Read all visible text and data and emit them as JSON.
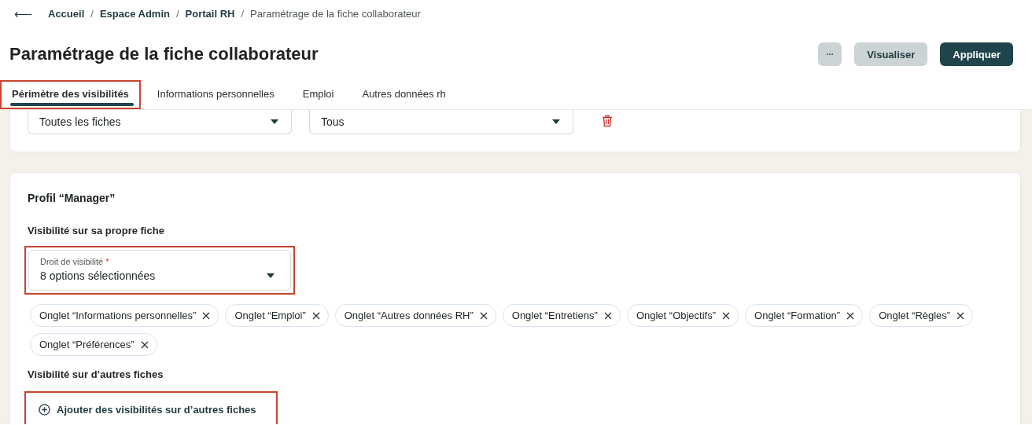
{
  "breadcrumb": {
    "back": "⟵",
    "separator": "/",
    "items": [
      {
        "label": "Accueil",
        "current": false
      },
      {
        "label": "Espace Admin",
        "current": false
      },
      {
        "label": "Portail RH",
        "current": false
      },
      {
        "label": "Paramétrage de la fiche collaborateur",
        "current": true
      }
    ]
  },
  "title": "Paramétrage de la fiche collaborateur",
  "actions": [
    {
      "kind": "more",
      "label": "···"
    },
    {
      "kind": "secondary",
      "label": "Visualiser"
    },
    {
      "kind": "primary",
      "label": "Appliquer"
    }
  ],
  "tabs": [
    {
      "label": "Périmètre des visibilités",
      "selected": true,
      "highlighted": true
    },
    {
      "label": "Informations personnelles",
      "selected": false,
      "highlighted": false
    },
    {
      "label": "Emploi",
      "selected": false,
      "highlighted": false
    },
    {
      "label": "Autres données rh",
      "selected": false,
      "highlighted": false
    }
  ],
  "filter_row": {
    "selects": [
      {
        "value": "Toutes les fiches"
      },
      {
        "value": "Tous"
      }
    ]
  },
  "profile": {
    "title": "Profil “Manager”",
    "own_section": "Visibilité sur sa propre fiche",
    "field": {
      "label": "Droit de visibilité",
      "required_mark": "*",
      "value": "8 options sélectionnées",
      "highlighted": true
    },
    "chips": [
      "Onglet “Informations personnelles”",
      "Onglet “Emploi”",
      "Onglet “Autres données RH”",
      "Onglet “Entretiens”",
      "Onglet “Objectifs”",
      "Onglet “Formation”",
      "Onglet “Règles”",
      "Onglet “Préférences”"
    ],
    "other_section": "Visibilité sur d’autres fiches",
    "add_button": {
      "label": "Ajouter des visibilités sur d’autres fiches",
      "highlighted": true
    }
  }
}
